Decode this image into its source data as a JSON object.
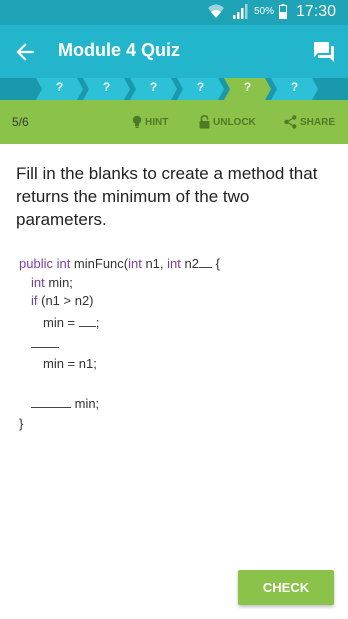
{
  "status_bar": {
    "battery": "50%",
    "time": "17:30"
  },
  "app_bar": {
    "title": "Module 4 Quiz"
  },
  "progress": {
    "steps": [
      {
        "label": "?",
        "state": "pending"
      },
      {
        "label": "?",
        "state": "pending"
      },
      {
        "label": "?",
        "state": "pending"
      },
      {
        "label": "?",
        "state": "pending"
      },
      {
        "label": "?",
        "state": "current"
      },
      {
        "label": "?",
        "state": "pending"
      }
    ]
  },
  "toolbar": {
    "counter": "5/6",
    "hint": "HINT",
    "unlock": "UNLOCK",
    "share": "SHARE"
  },
  "question": {
    "text": "Fill in the blanks to create a method that returns the minimum of the two parameters."
  },
  "code": {
    "line1": {
      "kw1": "public int",
      "t1": " minFunc(",
      "kw2": "int",
      "t2": " n1, ",
      "kw3": "int",
      "t3": " n2",
      "t4": " {"
    },
    "line2": {
      "kw": "int",
      "text": " min;"
    },
    "line3": {
      "kw": "if",
      "text": " (n1 > n2)"
    },
    "line4": {
      "text": "min = ",
      "end": ";"
    },
    "line6": {
      "text": "min = n1;"
    },
    "line8": {
      "text": " min;"
    },
    "line9": {
      "text": "}"
    }
  },
  "actions": {
    "check": "CHECK"
  },
  "colors": {
    "status_bar": "#1fa3b6",
    "app_bar": "#23b5cc",
    "progress_strip": "#1a98ac",
    "step": "#2cc1d6",
    "step_current": "#8bc34a",
    "toolbar": "#8bc34a",
    "keyword": "#7b3fa8"
  }
}
